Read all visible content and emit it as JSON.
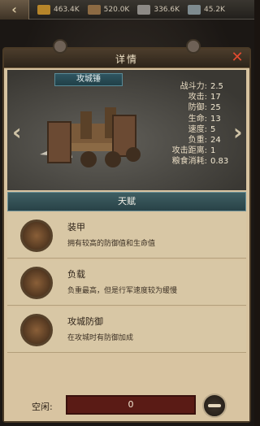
{
  "resources": [
    {
      "icon": "coin-icon",
      "value": "463.4K",
      "color": "#b6852a"
    },
    {
      "icon": "food-icon",
      "value": "520.0K",
      "color": "#8c6a43"
    },
    {
      "icon": "wood-icon",
      "value": "336.6K",
      "color": "#8d8a86"
    },
    {
      "icon": "stone-icon",
      "value": "45.2K",
      "color": "#7e8b8f"
    }
  ],
  "dialog": {
    "title": "详情",
    "unit_name": "攻城锤",
    "stats": [
      {
        "label": "战斗力:",
        "value": "2.5"
      },
      {
        "label": "攻击:",
        "value": "17"
      },
      {
        "label": "防御:",
        "value": "25"
      },
      {
        "label": "生命:",
        "value": "13"
      },
      {
        "label": "速度:",
        "value": "5"
      },
      {
        "label": "负重:",
        "value": "24"
      },
      {
        "label": "攻击距离:",
        "value": "1"
      },
      {
        "label": "粮食消耗:",
        "value": "0.83"
      }
    ],
    "talent_header": "天赋",
    "talents": [
      {
        "name": "装甲",
        "desc": "拥有较高的防御值和生命值",
        "icon": "armor-icon"
      },
      {
        "name": "负载",
        "desc": "负重最高，但是行军速度较为缓慢",
        "icon": "load-icon"
      },
      {
        "name": "攻城防御",
        "desc": "在攻城时有防御加成",
        "icon": "siege-defense-icon"
      }
    ],
    "idle_label": "空闲:",
    "idle_value": "0"
  }
}
